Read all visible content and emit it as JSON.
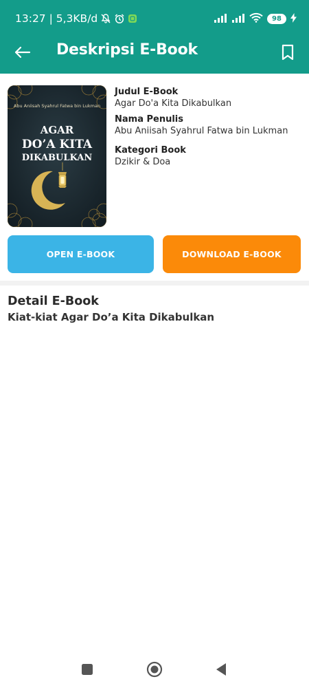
{
  "colors": {
    "primary": "#139c8a",
    "open_button": "#3bb4e6",
    "download_button": "#fb8a09"
  },
  "status_bar": {
    "time_speed": "13:27 | 5,3KB/d",
    "battery": "98",
    "icons": [
      "mute-icon",
      "alarm-icon",
      "app-notification-icon",
      "signal-icon",
      "signal-icon",
      "wifi-icon",
      "battery-icon",
      "charging-icon"
    ]
  },
  "app_bar": {
    "title": "Deskripsi E-Book",
    "back_icon": "arrow-back-icon",
    "bookmark_icon": "bookmark-icon"
  },
  "cover": {
    "author": "Abu Aniisah Syahrul Fatwa bin Lukman",
    "title_lines": [
      "AGAR",
      "DO’A KITA",
      "DIKABULKAN"
    ]
  },
  "book": {
    "title_label": "Judul E-Book",
    "title_value": "Agar Do'a Kita Dikabulkan",
    "author_label": "Nama Penulis",
    "author_value": "Abu Aniisah Syahrul Fatwa bin Lukman",
    "category_label": "Kategori Book",
    "category_value": "Dzikir & Doa"
  },
  "actions": {
    "open_label": "OPEN E-BOOK",
    "download_label": "DOWNLOAD E-BOOK"
  },
  "detail": {
    "heading": "Detail E-Book",
    "text": "Kiat-kiat Agar Do’a Kita Dikabulkan"
  },
  "nav_bar": {
    "icons": [
      "recent-apps-icon",
      "home-icon",
      "back-icon"
    ]
  }
}
